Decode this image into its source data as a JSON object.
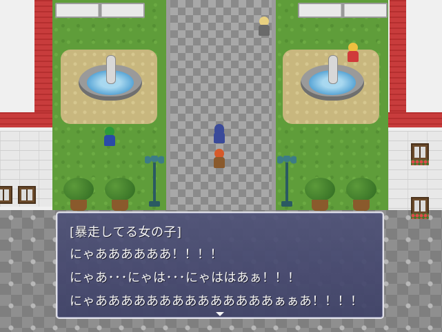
{
  "dialogue": {
    "speaker": "[暴走してる女の子]",
    "lines": [
      "にゃああああああ！！！！",
      "にゃあ･･･にゃは･･･にゃははあぁ！！！",
      "にゃああああああああああああああぁぁあ！！！！"
    ],
    "continue_indicator": "down-arrow-icon"
  },
  "colors": {
    "window_bg": "#4a4d73",
    "window_border": "#e8e8f0",
    "text": "#ffffff",
    "grass": "#5f9d3a",
    "roof": "#c83c3c"
  },
  "characters": [
    {
      "name": "player-hero",
      "hair": "#d65a2a",
      "clothing": "#8a5a2c"
    },
    {
      "name": "witch-npc",
      "hair": "#3a4a9a",
      "clothing": "#3a4a9a"
    },
    {
      "name": "green-haired-girl",
      "hair": "#2e9a3a",
      "clothing": "#2a4aa8"
    },
    {
      "name": "blonde-girl",
      "hair": "#f0c040",
      "clothing": "#d03a3a"
    },
    {
      "name": "maid-npc",
      "hair": "#e8d080",
      "clothing": "#6a6a6a"
    }
  ]
}
